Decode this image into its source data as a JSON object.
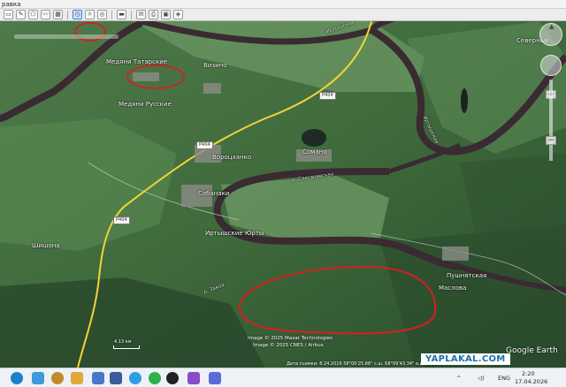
{
  "app": {
    "menu_label": "равка"
  },
  "toolbar": {
    "buttons": [
      "tb1",
      "tb2",
      "tb3",
      "tb4",
      "tb5",
      "tb6",
      "tb7",
      "tb8",
      "tb9",
      "tb10",
      "tb11",
      "tb12",
      "tb13",
      "tb14"
    ]
  },
  "map": {
    "places": [
      {
        "id": "medyany-tatarskie",
        "text": "Медяни Татарские"
      },
      {
        "id": "medyany-russkie",
        "text": "Медяни Русские"
      },
      {
        "id": "vizino",
        "text": "Визино"
      },
      {
        "id": "vorotyanka",
        "text": "Вороцханко"
      },
      {
        "id": "saranaki",
        "text": "Сабанаки"
      },
      {
        "id": "irtysh-yurty",
        "text": "Иртышские Юрты"
      },
      {
        "id": "shishona",
        "text": "Шишона"
      },
      {
        "id": "pushnaya",
        "text": "Пушнятская"
      },
      {
        "id": "maslova",
        "text": "Маслова"
      },
      {
        "id": "sevyerny",
        "text": "Северный"
      },
      {
        "id": "somano",
        "text": "Сомано"
      }
    ],
    "rivers": [
      {
        "id": "river-top",
        "text": "Иртышская"
      },
      {
        "id": "river-mid",
        "text": "р. Слесаревская"
      },
      {
        "id": "river-right",
        "text": "Иртышская"
      },
      {
        "id": "river-bottom",
        "text": "р. Замза"
      }
    ],
    "road_badges": [
      "Р404",
      "Р404",
      "Р404"
    ],
    "credit_lines": [
      "Image © 2025 Maxar Technologies",
      "Image © 2025 CNES / Airbus"
    ],
    "status": "Дата съемки: 8.24.2016     58°00'25.66\" с.ш. 68°09'43.34\" в.д. выс.",
    "scale_label": "4.13 км",
    "logo": "Google Earth",
    "watermark": "YAPLAKAL.COM"
  },
  "taskbar": {
    "lang": "ENG",
    "time": "2:20",
    "date": "17.04.2026"
  },
  "colors": {
    "annotation": "#d61f1f",
    "river": "#3a2a32",
    "road": "#f2d33a"
  }
}
